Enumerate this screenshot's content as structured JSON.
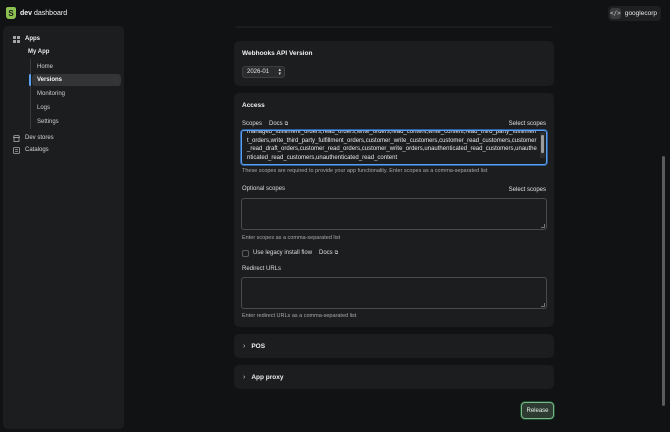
{
  "topbar": {
    "brand_bold": "dev",
    "brand_rest": " dashboard",
    "org_icon": "</>",
    "org_name": "googlecorp"
  },
  "sidebar": {
    "apps_label": "Apps",
    "app_name": "My App",
    "sub_items": [
      "Home",
      "Versions",
      "Monitoring",
      "Logs",
      "Settings"
    ],
    "active_item": "Versions",
    "dev_stores": "Dev stores",
    "catalogs": "Catalogs"
  },
  "webhooks": {
    "title": "Webhooks API Version",
    "version": "2026-01"
  },
  "access": {
    "title": "Access",
    "scopes_label": "Scopes",
    "docs_label": "Docs",
    "select_scopes": "Select scopes",
    "scopes_value": "managed_fulfillment_orders,read_orders,write_orders,read_content,write_content,read_third_party_fulfillment_orders,write_third_party_fulfillment_orders,customer_write_customers,customer_read_customers,customer_read_draft_orders,customer_read_orders,customer_write_orders,unauthenticated_read_customers,unauthenticated_read_customers,unauthenticated_read_content",
    "scopes_help": "These scopes are required to provide your app functionality. Enter scopes as a comma-separated list",
    "optional_label": "Optional scopes",
    "optional_select": "Select scopes",
    "optional_value": "",
    "optional_help": "Enter scopes as a comma-separated list",
    "legacy_label": "Use legacy install flow",
    "legacy_docs": "Docs",
    "redirect_label": "Redirect URLs",
    "redirect_value": "",
    "redirect_help": "Enter redirect URLs as a comma-separated list"
  },
  "sections": {
    "pos": "POS",
    "app_proxy": "App proxy"
  },
  "release_label": "Release",
  "colors": {
    "accent_blue": "#5aa0f2",
    "brand_green": "#8cc152",
    "release_border": "#7ab88a"
  }
}
